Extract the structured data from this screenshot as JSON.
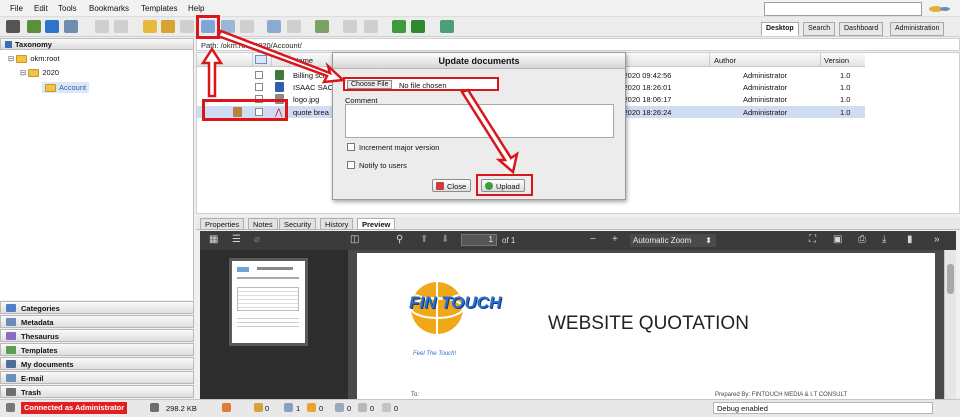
{
  "menu": {
    "items": [
      "File",
      "Edit",
      "Tools",
      "Bookmarks",
      "Templates",
      "Help"
    ]
  },
  "search": {
    "placeholder": ""
  },
  "workspace_tabs": [
    {
      "label": "Desktop",
      "active": true
    },
    {
      "label": "Search",
      "active": false
    },
    {
      "label": "Dashboard",
      "active": false
    },
    {
      "label": "Administration",
      "active": false
    }
  ],
  "left": {
    "title": "Taxonomy",
    "tree": {
      "root": "okm:root",
      "year": "2020",
      "selected": "Account"
    },
    "accordion": [
      "Categories",
      "Metadata",
      "Thesaurus",
      "Templates",
      "My documents",
      "E-mail",
      "Trash"
    ]
  },
  "path": {
    "text": "Path: /okm:root/2020/Account/"
  },
  "grid": {
    "headers": {
      "name": "Name",
      "author": "Author",
      "version": "Version"
    },
    "rows": [
      {
        "name": "Billing sch",
        "date": "-2020 09:42:56",
        "author": "Administrator",
        "version": "1.0",
        "selected": false
      },
      {
        "name": "ISAAC SAC",
        "date": "-2020 18:26:01",
        "author": "Administrator",
        "version": "1.0",
        "selected": false
      },
      {
        "name": "logo.jpg",
        "date": "-2020 18:06:17",
        "author": "Administrator",
        "version": "1.0",
        "selected": false
      },
      {
        "name": "quote brea",
        "date": "-2020 18:26:24",
        "author": "Administrator",
        "version": "1.0",
        "selected": true
      }
    ]
  },
  "dialog": {
    "title": "Update documents",
    "choose_file": "Choose File",
    "no_file": "No file chosen",
    "comment_label": "Comment",
    "increment_label": "Increment major version",
    "notify_label": "Notify to users",
    "close_label": "Close",
    "upload_label": "Upload"
  },
  "bottom_tabs": [
    {
      "label": "Properties",
      "active": false
    },
    {
      "label": "Notes",
      "active": false
    },
    {
      "label": "Security",
      "active": false
    },
    {
      "label": "History",
      "active": false
    },
    {
      "label": "Preview",
      "active": true
    }
  ],
  "pdf": {
    "page_number": "1",
    "page_total": "of 1",
    "zoom": "Automatic Zoom",
    "doc_title": "WEBSITE QUOTATION",
    "brand": "FIN TOUCH",
    "tagline": "Feel The Touch!",
    "bottom_left": "To:",
    "bottom_right": "Prepared By:      FINTOUCH MEDIA & I.T CONSULT"
  },
  "status": {
    "connected": "Connected as Administrator",
    "size": "298.2 KB",
    "counts": [
      "0",
      "1",
      "0",
      "0",
      "0",
      "0"
    ],
    "debug": "Debug enabled"
  },
  "colors": {
    "annotation_red": "#d9161c",
    "selection": "#cfdcf2",
    "accent_blue": "#2a5db0"
  }
}
